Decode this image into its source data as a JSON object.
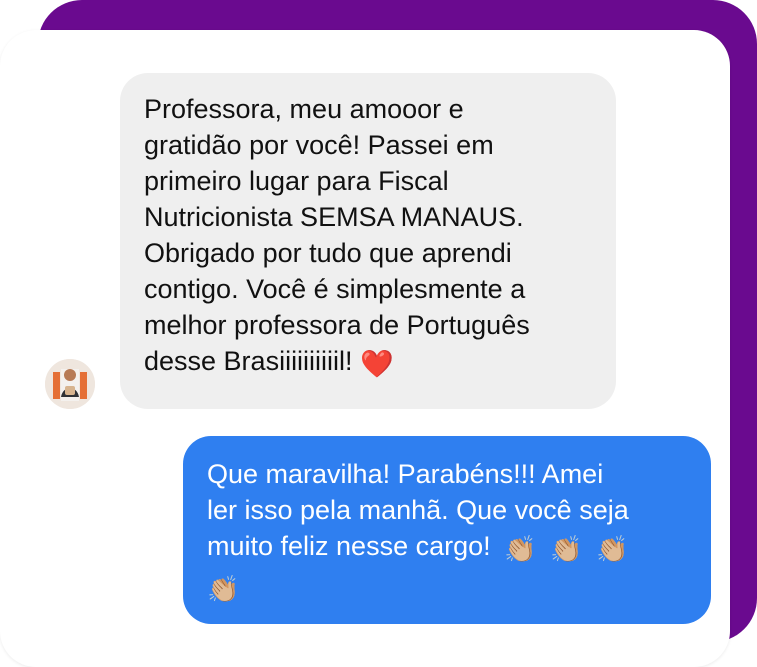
{
  "conversation": {
    "incoming_message": {
      "lines": [
        "Professora, meu amooor e",
        "gratidão por você! Passei em",
        "primeiro lugar para Fiscal",
        "Nutricionista SEMSA MANAUS.",
        "Obrigado por tudo que aprendi",
        "contigo. Você é simplesmente a",
        "melhor professora de Português",
        "desse Brasiiiiiiiiiil!"
      ],
      "emoji": "❤️"
    },
    "outgoing_message": {
      "lines": [
        "Que maravilha! Parabéns!!! Amei",
        "ler isso pela manhã. Que você seja",
        "muito feliz nesse cargo!"
      ],
      "emojis": [
        "👏🏼",
        "👏🏼",
        "👏🏼",
        "👏🏼"
      ]
    }
  },
  "colors": {
    "frame_purple": "#6a0a8f",
    "incoming_bubble": "#efefef",
    "outgoing_bubble": "#2f7ff0",
    "incoming_text": "#111111",
    "outgoing_text": "#ffffff"
  },
  "icons": {
    "avatar": "user-avatar-photo",
    "heart": "red-heart-emoji",
    "clap": "clapping-hands-emoji"
  }
}
